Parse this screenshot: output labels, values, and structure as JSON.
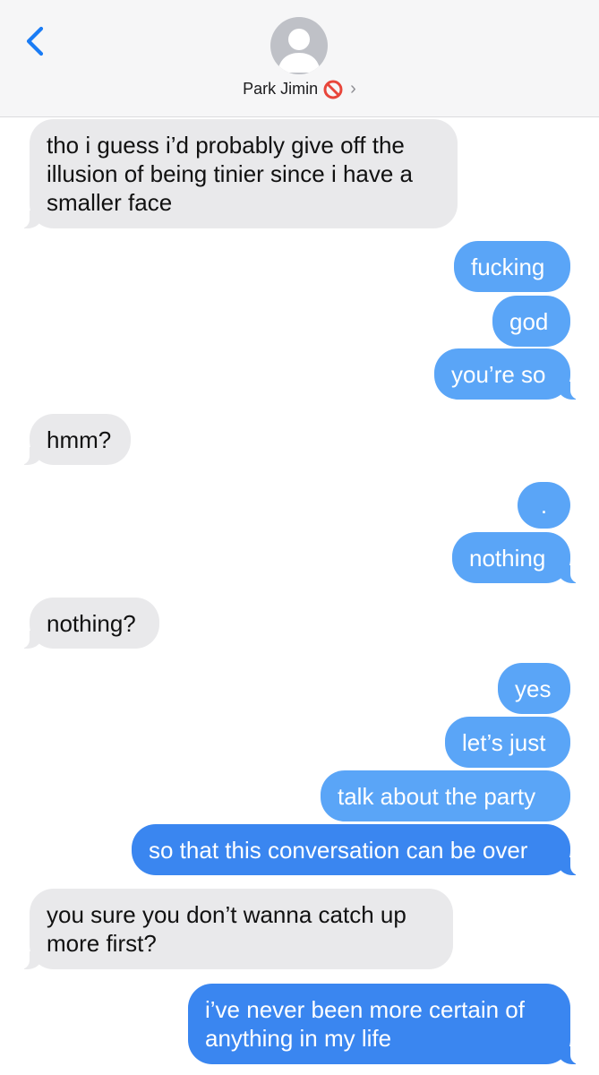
{
  "header": {
    "back_icon": "chevron-left-icon",
    "avatar_icon": "person-silhouette-icon",
    "contact_name": "Park Jimin",
    "contact_badge_icon": "no-entry-emoji",
    "disclosure_icon": "chevron-right-icon",
    "disclosure_glyph": "›"
  },
  "colors": {
    "incoming_bubble": "#e9e9eb",
    "outgoing_bubble": "#5aa5f7",
    "outgoing_bubble_deep": "#3a86f0",
    "accent": "#1a7cf5"
  },
  "messages": [
    {
      "from": "them",
      "text_lines": [
        "tho i guess i’d probably give off the",
        "illusion of being tinier since i have a",
        "smaller face"
      ]
    },
    {
      "from": "me",
      "text": "fucking"
    },
    {
      "from": "me",
      "text": "god"
    },
    {
      "from": "me",
      "text": "you’re so"
    },
    {
      "from": "them",
      "text": "hmm?"
    },
    {
      "from": "me",
      "text": "."
    },
    {
      "from": "me",
      "text": "nothing"
    },
    {
      "from": "them",
      "text": "nothing?"
    },
    {
      "from": "me",
      "text": "yes"
    },
    {
      "from": "me",
      "text": "let’s just"
    },
    {
      "from": "me",
      "text": "talk about the party"
    },
    {
      "from": "me",
      "text": "so that this conversation can be over"
    },
    {
      "from": "them",
      "text_lines": [
        "you sure you don’t wanna catch up",
        "more first?"
      ]
    },
    {
      "from": "me",
      "text_lines": [
        "i’ve never been more certain of",
        "anything in my life"
      ]
    }
  ]
}
